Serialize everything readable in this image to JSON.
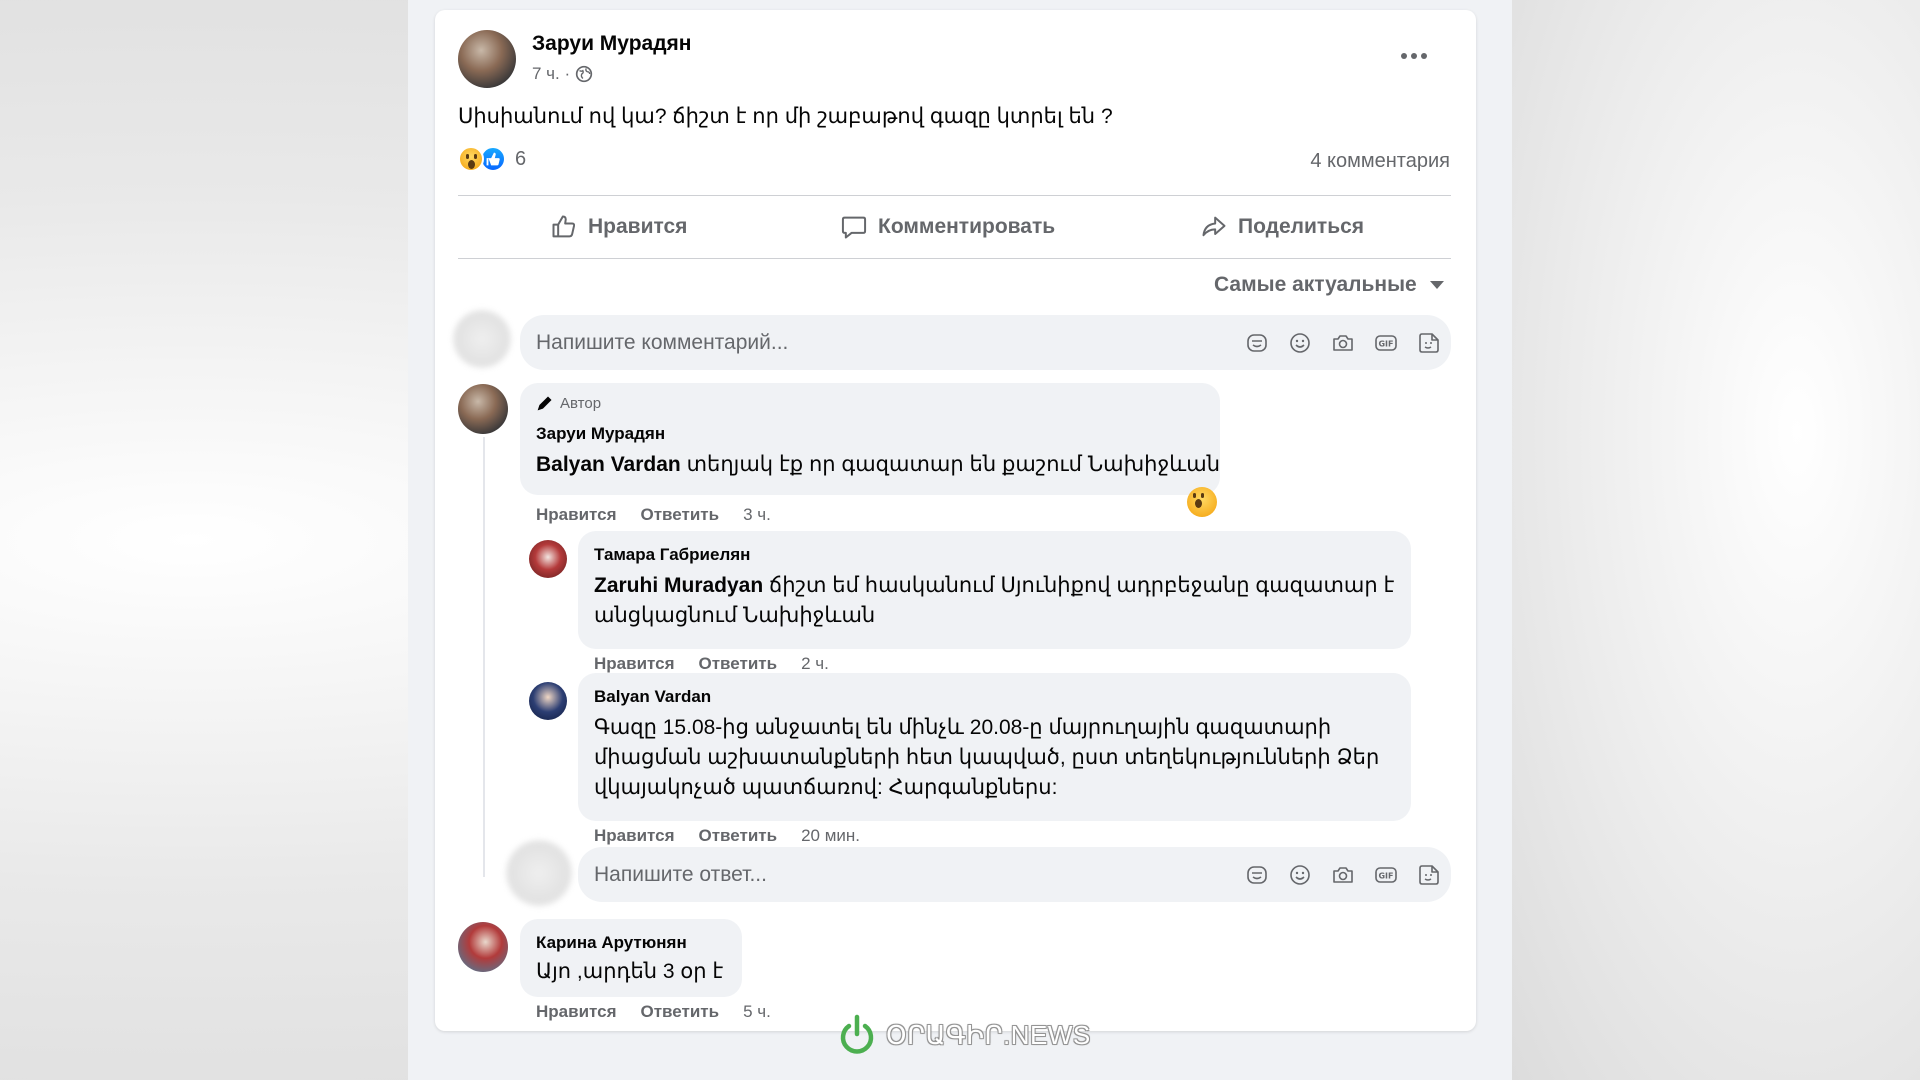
{
  "post": {
    "author": "Заруи Мурадян",
    "time": "7 ч. ·",
    "text": "Սիսիանում ով կա? ճիշտ է որ մի շաբաթով գազը կտրել են ?",
    "reaction_count": "6",
    "comments_count": "4 комментария",
    "reactions": [
      "wow",
      "like"
    ]
  },
  "actions": {
    "like": "Нравится",
    "comment": "Комментировать",
    "share": "Поделиться"
  },
  "sort": {
    "label": "Самые актуальные"
  },
  "comment_input": {
    "placeholder": "Напишите комментарий..."
  },
  "reply_input": {
    "placeholder": "Напишите ответ..."
  },
  "comments": [
    {
      "badge": "Автор",
      "name": "Заруи Мурадян",
      "mention": "Balyan Vardan",
      "text": " տեղյակ էք որ գազատար են քաշում Նախիջևան",
      "like": "Нравится",
      "reply": "Ответить",
      "time": "3 ч.",
      "replies": [
        {
          "name": "Тамара Габриелян",
          "mention": "Zaruhi Muradyan",
          "text_line1": " ճիշտ եմ հասկանում Սյունիքով ադրբեջանը գազատար է",
          "text_line2": "անցկացնում Նախիջևան",
          "like": "Нравится",
          "reply": "Ответить",
          "time": "2 ч."
        },
        {
          "name": "Balyan Vardan",
          "text_line1": "Գազը 15.08-ից անջատել են մինչև 20.08-ը մայրուղային գազատարի",
          "text_line2": "միացման աշխատանքների հետ կապված, ըստ տեղեկությունների Ձեր",
          "text_line3": "վկայակոչած պատճառով: Հարգանքներս:",
          "like": "Нравится",
          "reply": "Ответить",
          "time": "20 мин."
        }
      ]
    },
    {
      "name": "Карина Арутюнян",
      "text": "Այո ,արդեն 3 օր է",
      "like": "Нравится",
      "reply": "Ответить",
      "time": "5 ч."
    }
  ],
  "watermark": "ՕՐԱԳԻՐ.NEWS",
  "colors": {
    "primary_text": "#050505",
    "secondary_text": "#65676b",
    "input_bg": "#f0f2f5",
    "like_blue": "#0866ff",
    "wow_yellow": "#f7b125"
  }
}
